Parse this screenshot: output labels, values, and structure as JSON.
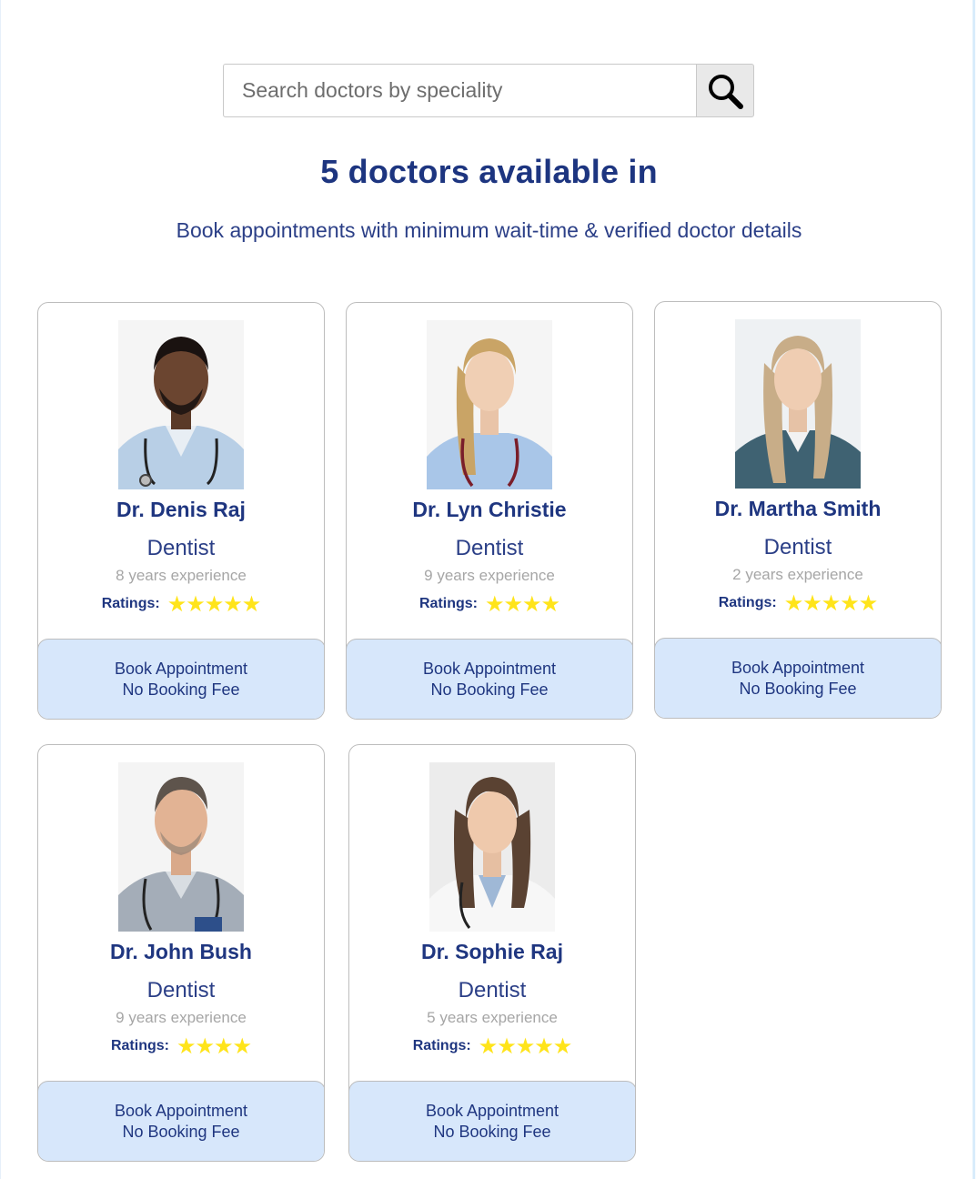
{
  "search": {
    "placeholder": "Search doctors by speciality",
    "button_icon": "search-icon"
  },
  "results": {
    "title": "5 doctors available in",
    "subtitle": "Book appointments with minimum wait-time & verified doctor details"
  },
  "labels": {
    "ratings": "Ratings:",
    "book_line1": "Book Appointment",
    "book_line2": "No Booking Fee"
  },
  "colors": {
    "primary_text": "#1f3680",
    "button_bg": "#d7e7fb",
    "star": "#ffe41a",
    "muted_text": "#a6a6a6"
  },
  "doctors": [
    {
      "name": "Dr. Denis Raj",
      "speciality": "Dentist",
      "experience": "8 years experience",
      "rating": 5
    },
    {
      "name": "Dr. Lyn Christie",
      "speciality": "Dentist",
      "experience": "9 years experience",
      "rating": 4
    },
    {
      "name": "Dr. Martha Smith",
      "speciality": "Dentist",
      "experience": "2 years experience",
      "rating": 5
    },
    {
      "name": "Dr. John Bush",
      "speciality": "Dentist",
      "experience": "9 years experience",
      "rating": 4
    },
    {
      "name": "Dr. Sophie Raj",
      "speciality": "Dentist",
      "experience": "5 years experience",
      "rating": 5
    }
  ]
}
